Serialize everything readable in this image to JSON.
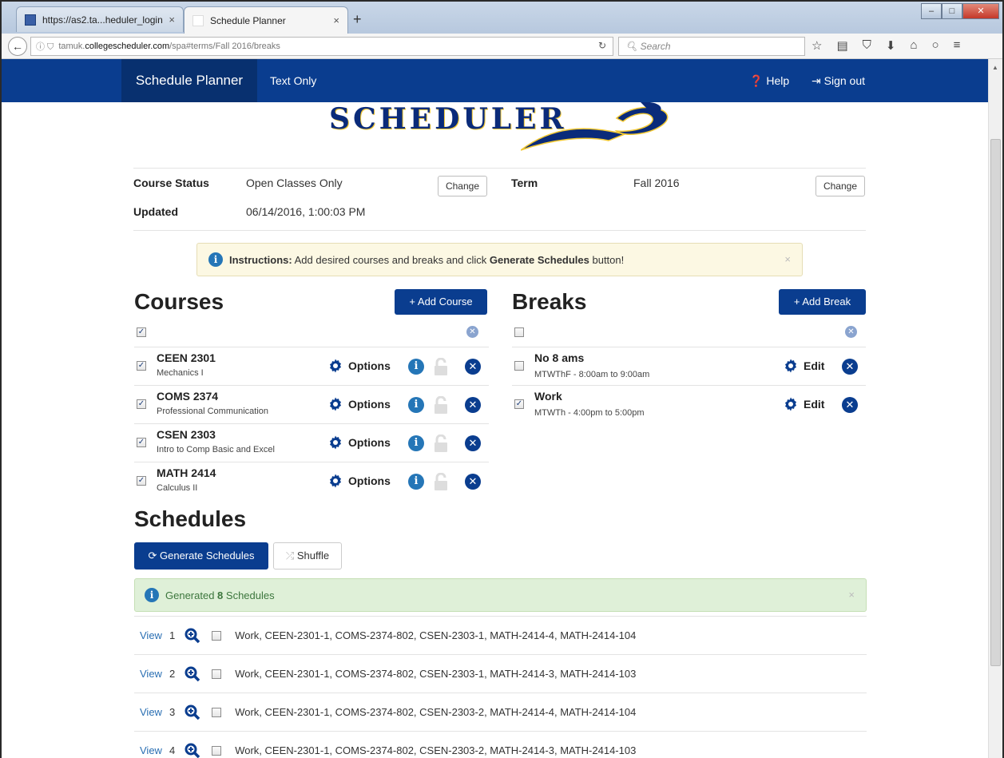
{
  "browser": {
    "tabs": [
      {
        "label": "https://as2.ta...heduler_login",
        "close": "×"
      },
      {
        "label": "Schedule Planner",
        "close": "×"
      }
    ],
    "new_tab": "+",
    "url_prefix": "tamuk.",
    "url_host": "collegescheduler.com",
    "url_path": "/spa#terms/Fall 2016/breaks",
    "search_placeholder": "Search"
  },
  "app": {
    "brand": "Schedule Planner",
    "nav_text_only": "Text Only",
    "nav_help": "Help",
    "nav_signout": "Sign out",
    "logo_text": "SCHEDULER"
  },
  "status": {
    "course_status_label": "Course Status",
    "course_status_value": "Open Classes Only",
    "change_label": "Change",
    "updated_label": "Updated",
    "updated_value": "06/14/2016, 1:00:03 PM",
    "term_label": "Term",
    "term_value": "Fall 2016"
  },
  "instructions": {
    "lead": "Instructions:",
    "text_a": " Add desired courses and breaks and click ",
    "bold": "Generate Schedules",
    "text_b": " button!",
    "close": "×"
  },
  "courses": {
    "title": "Courses",
    "add_label": "+ Add Course",
    "options_label": "Options",
    "items": [
      {
        "code": "CEEN 2301",
        "name": "Mechanics I"
      },
      {
        "code": "COMS 2374",
        "name": "Professional Communication"
      },
      {
        "code": "CSEN 2303",
        "name": "Intro to Comp Basic and Excel"
      },
      {
        "code": "MATH 2414",
        "name": "Calculus II"
      }
    ]
  },
  "breaks": {
    "title": "Breaks",
    "add_label": "+ Add Break",
    "edit_label": "Edit",
    "items": [
      {
        "name": "No 8 ams",
        "time": "MTWThF - 8:00am to 9:00am",
        "checked": false
      },
      {
        "name": "Work",
        "time": "MTWTh - 4:00pm to 5:00pm",
        "checked": true
      }
    ]
  },
  "schedules": {
    "title": "Schedules",
    "generate_label": "Generate Schedules",
    "shuffle_label": "Shuffle",
    "generated_prefix": "Generated ",
    "generated_count": "8",
    "generated_suffix": " Schedules",
    "success_close": "×",
    "view_label": "View",
    "rows": [
      {
        "num": "1",
        "text": "Work, CEEN-2301-1, COMS-2374-802, CSEN-2303-1, MATH-2414-4, MATH-2414-104"
      },
      {
        "num": "2",
        "text": "Work, CEEN-2301-1, COMS-2374-802, CSEN-2303-1, MATH-2414-3, MATH-2414-103"
      },
      {
        "num": "3",
        "text": "Work, CEEN-2301-1, COMS-2374-802, CSEN-2303-2, MATH-2414-4, MATH-2414-104"
      },
      {
        "num": "4",
        "text": "Work, CEEN-2301-1, COMS-2374-802, CSEN-2303-2, MATH-2414-3, MATH-2414-103"
      }
    ]
  },
  "colors": {
    "brand_blue": "#0a3d8f",
    "info_blue": "#2576b7",
    "link_blue": "#2a6fb3",
    "success_green": "#3c763d",
    "warn_bg": "#fcf8e3"
  }
}
